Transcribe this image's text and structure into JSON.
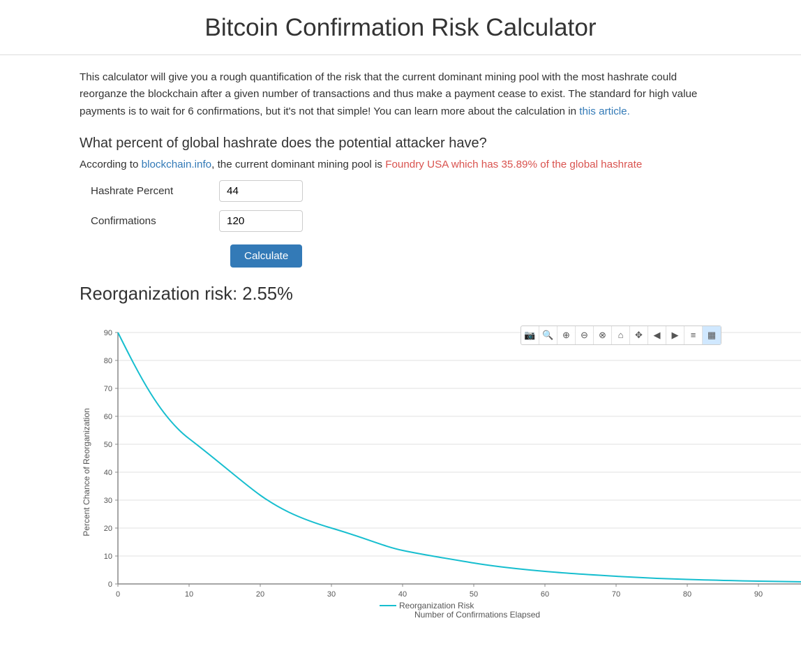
{
  "page": {
    "title": "Bitcoin Confirmation Risk Calculator"
  },
  "description": {
    "text1": "This calculator will give you a rough quantification of the risk that the current dominant mining pool with the most hashrate could reorganze the blockchain after a given number of transactions and thus make a payment cease to exist. The standard for high value payments is to wait for 6 confirmations, but it's not that simple! You can learn more about the calculation in ",
    "link_text": "this article.",
    "link_url": "#"
  },
  "section": {
    "question": "What percent of global hashrate does the potential attacker have?",
    "attacker_prefix": "According to ",
    "blockchain_link": "blockchain.info",
    "blockchain_url": "#",
    "attacker_suffix": ", the current dominant mining pool is ",
    "dominant_pool": "Foundry USA which has 35.89% of the global hashrate"
  },
  "form": {
    "hashrate_label": "Hashrate Percent",
    "hashrate_value": "44",
    "confirmations_label": "Confirmations",
    "confirmations_value": "120",
    "calculate_label": "Calculate"
  },
  "result": {
    "label": "Reorganization risk: 2.55%"
  },
  "chart": {
    "x_label": "Number of Confirmations Elapsed",
    "y_label": "Percent Chance of Reorganization",
    "legend_label": "Reorganization Risk",
    "toolbar": {
      "camera": "📷",
      "zoom_in": "🔍",
      "zoom_plus": "+",
      "box_select": "⊕",
      "box_minus": "⊖",
      "lasso": "⊗",
      "home": "⌂",
      "spike": "✥",
      "pan_left": "◀",
      "pan_right": "▶",
      "compare": "≡",
      "toggle_spike": "▦"
    }
  }
}
